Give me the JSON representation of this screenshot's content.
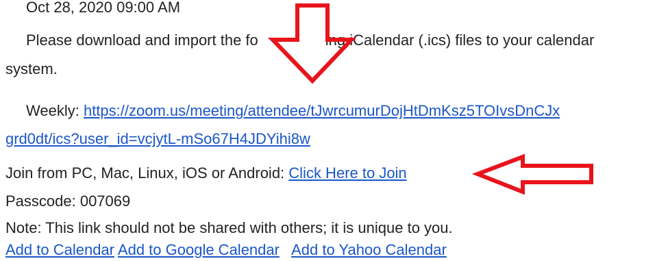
{
  "meeting": {
    "datetime": "Oct 28, 2020 09:00 AM",
    "ics_instruction_part1": "Please download and import the fo",
    "ics_instruction_part2": "ing iCalendar (.ics) files to your calendar",
    "ics_instruction_part3": "system.",
    "weekly_label": "Weekly: ",
    "weekly_url_line1": "https://zoom.us/meeting/attendee/tJwrcumurDojHtDmKsz5TOIvsDnCJx",
    "weekly_url_line2": "grd0dt/ics?user_id=vcjytL-mSo67H4JDYihi8w",
    "join_label": "Join from PC, Mac, Linux, iOS or Android: ",
    "join_link": "Click Here to Join",
    "passcode": "Passcode: 007069",
    "note": "Note: This link should not be shared with others; it is unique to you.",
    "add_to_calendar": "Add to Calendar",
    "add_to_google_calendar": "Add to Google Calendar",
    "add_to_yahoo_calendar": "Add to Yahoo Calendar"
  },
  "colors": {
    "link": "#1a56c9",
    "text": "#222222",
    "arrow": "#e8141c"
  },
  "icons": [
    "down-arrow-annotation-icon",
    "left-arrow-annotation-icon"
  ]
}
